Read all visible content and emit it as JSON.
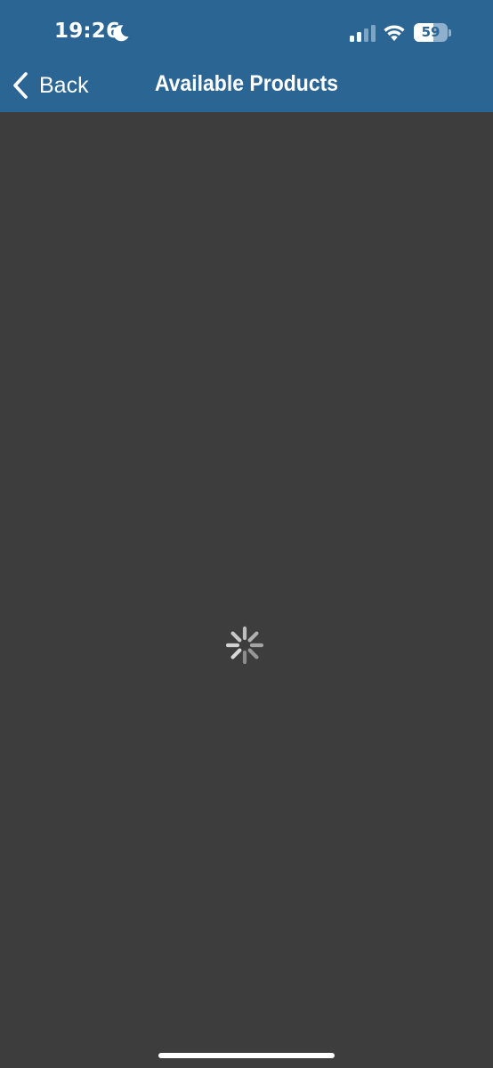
{
  "status_bar": {
    "time": "19:26",
    "battery_level": "59",
    "battery_fraction": 0.59,
    "icons": [
      "moon-icon",
      "signal-icon",
      "wifi-icon",
      "battery-icon"
    ]
  },
  "nav": {
    "back_label": "Back",
    "title": "Available Products"
  },
  "content": {
    "state": "loading",
    "spinner_icon": "activity-spinner-icon"
  },
  "colors": {
    "header_background": "#2b6594",
    "content_background": "#3d3d3d",
    "text": "#ffffff",
    "spinner": "#9a9a9a"
  }
}
